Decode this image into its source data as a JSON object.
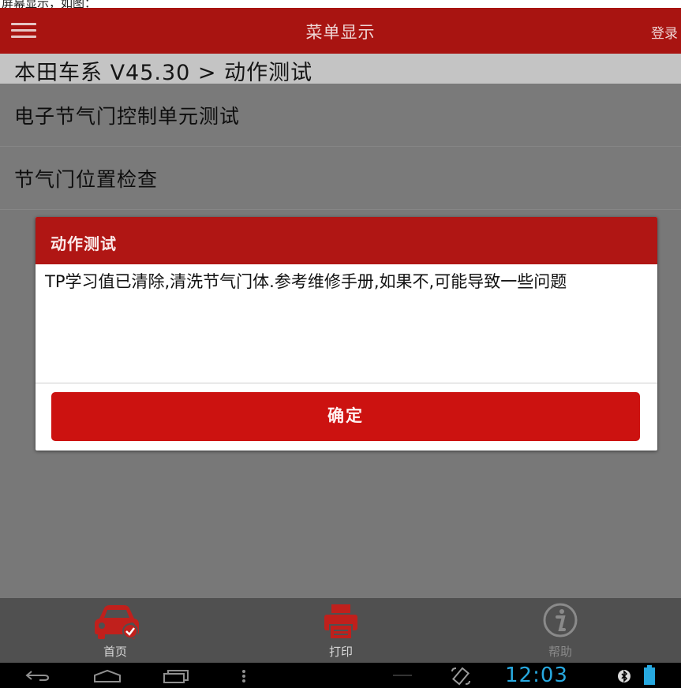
{
  "caption_fragment": "屏幕显示，如图：",
  "app": {
    "title": "菜单显示",
    "login_label": "登录"
  },
  "breadcrumb": "本田车系 V45.30 > 动作测试",
  "menu_items": [
    {
      "label": "电子节气门控制单元测试"
    },
    {
      "label": "节气门位置检查"
    }
  ],
  "dialog": {
    "title": "动作测试",
    "message": "TP学习值已清除,清洗节气门体.参考维修手册,如果不,可能导致一些问题",
    "ok_label": "确定"
  },
  "bottom_nav": [
    {
      "label": "首页",
      "icon": "car-check-icon",
      "color": "#c0201c"
    },
    {
      "label": "打印",
      "icon": "printer-icon",
      "color": "#c0201c"
    },
    {
      "label": "帮助",
      "icon": "info-icon",
      "color": "#8a8a8a"
    }
  ],
  "status_bar": {
    "time": "12:03",
    "icons": [
      "back-icon",
      "home-icon",
      "recents-icon",
      "overflow-menu-icon",
      "rotation-icon",
      "bluetooth-icon",
      "battery-icon"
    ]
  },
  "colors": {
    "brand_red": "#a81411",
    "button_red": "#cc1210",
    "clock_blue": "#27a9e0"
  }
}
